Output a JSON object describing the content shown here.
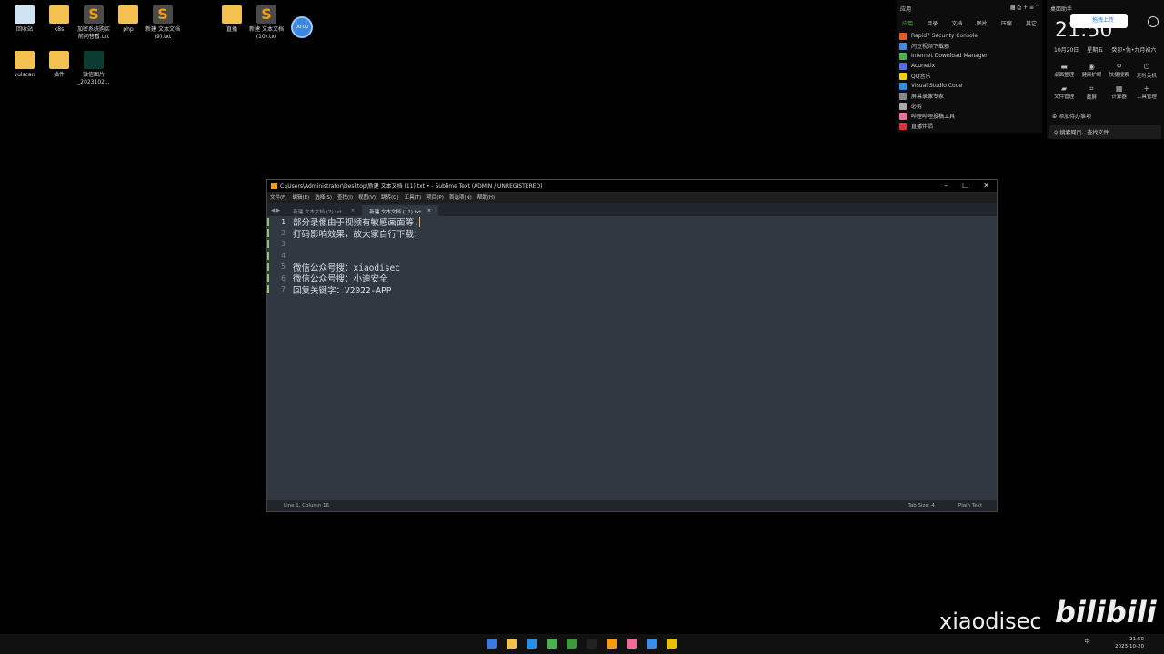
{
  "desktop": {
    "icons": [
      {
        "label": "回收站",
        "type": "bin"
      },
      {
        "label": "k8s",
        "type": "folder"
      },
      {
        "label": "加密系统购买前问答看.txt",
        "type": "subl"
      },
      {
        "label": "php",
        "type": "folder"
      },
      {
        "label": "新建 文本文档 (9).txt",
        "type": "subl"
      },
      {
        "label": "直播",
        "type": "folder"
      },
      {
        "label": "新建 文本文档 (10).txt",
        "type": "subl"
      },
      {
        "label": "vulscan",
        "type": "folder"
      },
      {
        "label": "插件",
        "type": "folder"
      },
      {
        "label": "微信图片_2023102...",
        "type": "img"
      }
    ],
    "clock_widget": "00:00"
  },
  "apps_panel": {
    "title": "应用",
    "tabs": [
      "应用",
      "目录",
      "文档",
      "图片",
      "压缩",
      "其它"
    ],
    "items": [
      {
        "label": "Rapid7 Security Console",
        "color": "#e05a2b"
      },
      {
        "label": "闪豆视频下载器",
        "color": "#3a8ee6"
      },
      {
        "label": "Internet Download Manager",
        "color": "#4caf50"
      },
      {
        "label": "Acunetix",
        "color": "#5a6de0"
      },
      {
        "label": "QQ音乐",
        "color": "#f5d000"
      },
      {
        "label": "Visual Studio Code",
        "color": "#2a8ee6"
      },
      {
        "label": "屏幕录像专家",
        "color": "#888888"
      },
      {
        "label": "必剪",
        "color": "#aaaaaa"
      },
      {
        "label": "哔哩哔哩投稿工具",
        "color": "#f06a9a"
      },
      {
        "label": "直播伴侣",
        "color": "#e03040"
      }
    ]
  },
  "assistant": {
    "title": "桌面助手",
    "time": "21:50",
    "upload": "拖拽上传",
    "date": "10月20日",
    "weekday": "星期五",
    "lunar": "癸卯•兔•九月初六",
    "tools": [
      {
        "icon": "▬",
        "label": "桌面整理"
      },
      {
        "icon": "◉",
        "label": "健康护眼"
      },
      {
        "icon": "⚲",
        "label": "快捷搜索"
      },
      {
        "icon": "⏻",
        "label": "定时关机"
      },
      {
        "icon": "▰",
        "label": "文件管理"
      },
      {
        "icon": "⌗",
        "label": "截屏"
      },
      {
        "icon": "▦",
        "label": "计算器"
      },
      {
        "icon": "+",
        "label": "工具管理"
      }
    ],
    "todo": "添加待办事项",
    "search": "搜索网页、查找文件"
  },
  "window": {
    "title": "C:\\Users\\Administrator\\Desktop\\新建 文本文档 (11).txt • - Sublime Text (ADMIN / UNREGISTERED)",
    "menu": [
      "文件(F)",
      "编辑(E)",
      "选择(S)",
      "查找(I)",
      "视图(V)",
      "跳转(G)",
      "工具(T)",
      "项目(P)",
      "首选项(N)",
      "帮助(H)"
    ],
    "tabs": [
      {
        "label": "新建 文本文档 (7).txt",
        "active": false
      },
      {
        "label": "新建 文本文档 (11).txt",
        "active": true
      }
    ],
    "lines": [
      "部分录像由于视频有敏感画面等,",
      "打码影响效果，故大家自行下载！",
      "",
      "",
      "微信公众号搜：xiaodisec",
      "微信公众号搜：小迪安全",
      "回复关键字：V2022-APP"
    ],
    "status": {
      "position": "Line 1, Column 16",
      "tab_size": "Tab Size: 4",
      "syntax": "Plain Text"
    }
  },
  "watermark": {
    "text": "xiaodisec",
    "logo": "bilibili"
  },
  "taskbar": {
    "time": "21:50",
    "date": "2023-10-20",
    "ime": "中"
  }
}
